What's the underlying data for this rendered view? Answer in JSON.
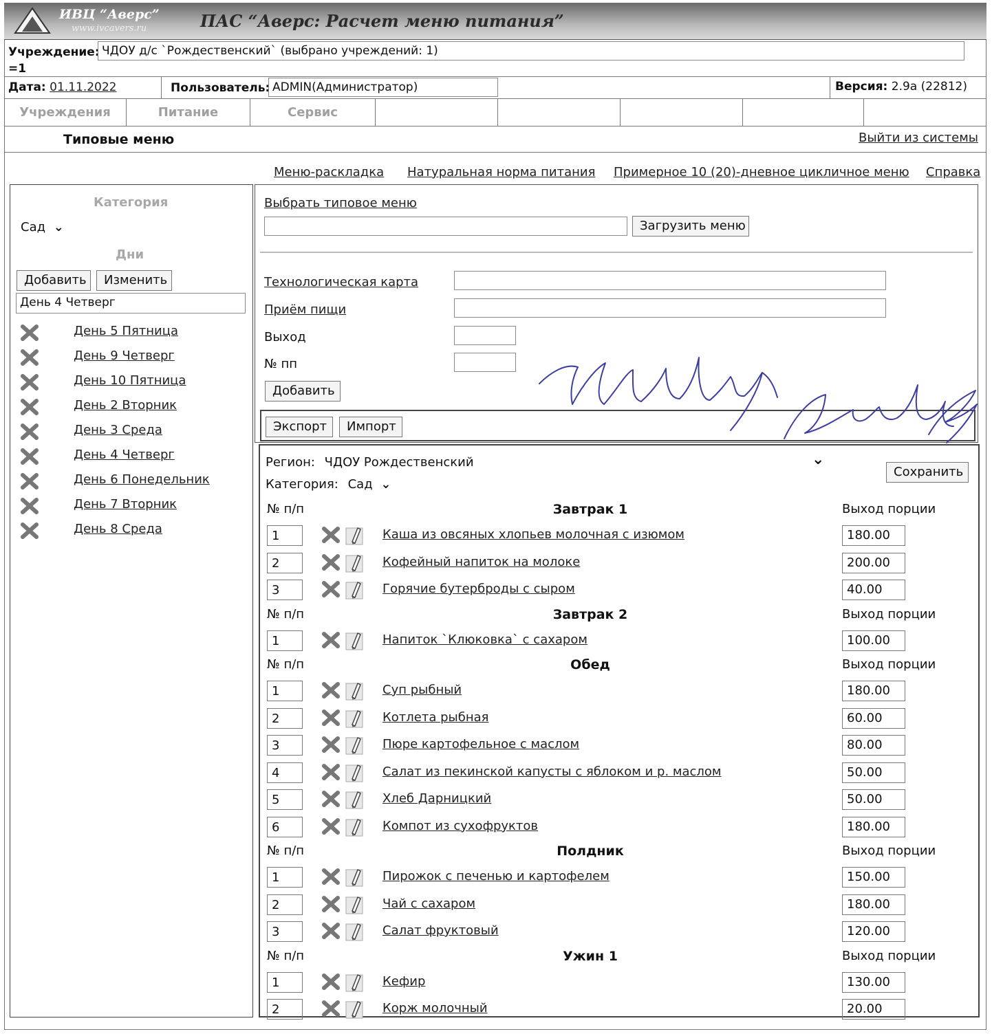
{
  "header": {
    "brand": "ИВЦ “Аверс”",
    "url": "www.ivcavers.ru",
    "app_title": "ПАС “Аверс: Расчет меню питания”"
  },
  "institution": {
    "label": "Учреждение:",
    "value": "ЧДОУ д/с `Рождественский` (выбрано учреждений: 1)",
    "extra": "=1"
  },
  "info": {
    "date_label": "Дата:",
    "date_value": "01.11.2022",
    "user_label": "Пользователь:",
    "user_value": "ADMIN(Администратор)",
    "version_label": "Версия:",
    "version_value": "2.9а (22812)"
  },
  "nav": {
    "items": [
      "Учреждения",
      "Питание",
      "Сервис"
    ]
  },
  "subheader": {
    "title": "Типовые меню",
    "logout": "Выйти из системы"
  },
  "links": {
    "layout": "Меню-раскладка",
    "norm": "Натуральная норма питания",
    "cyclic": "Примерное 10 (20)-дневное цикличное меню",
    "help": "Справка"
  },
  "left": {
    "category_label": "Категория",
    "category_value": "Сад",
    "days_label": "Дни",
    "add_btn": "Добавить",
    "edit_btn": "Изменить",
    "day_input": "День 4 Четверг",
    "days": [
      "День 5 Пятница",
      "День 9 Четверг",
      "День 10 Пятница",
      "День 2 Вторник",
      "День 3 Среда",
      "День 4 Четверг",
      "День 6 Понедельник",
      "День 7 Вторник",
      "День 8 Среда"
    ]
  },
  "form": {
    "choose_menu": "Выбрать типовое меню",
    "load_btn": "Загрузить меню",
    "tech_card": "Технологическая карта",
    "meal": "Приём пищи",
    "output": "Выход",
    "num": "№ пп",
    "add_btn": "Добавить",
    "export_btn": "Экспорт",
    "import_btn": "Импорт"
  },
  "menu": {
    "region_label": "Регион:",
    "region_value": "ЧДОУ Рождественский",
    "category_label": "Категория:",
    "category_value": "Сад",
    "save_btn": "Сохранить",
    "num_header": "№ п/п",
    "output_header": "Выход порции",
    "sections": [
      {
        "name": "Завтрак 1",
        "items": [
          {
            "num": "1",
            "dish": "Каша из овсяных хлопьев молочная с изюмом",
            "qty": "180.00"
          },
          {
            "num": "2",
            "dish": "Кофейный напиток на молоке",
            "qty": "200.00"
          },
          {
            "num": "3",
            "dish": "Горячие бутерброды с сыром",
            "qty": "40.00"
          }
        ]
      },
      {
        "name": "Завтрак 2",
        "items": [
          {
            "num": "1",
            "dish": "Напиток `Клюковка` с сахаром",
            "qty": "100.00"
          }
        ]
      },
      {
        "name": "Обед",
        "items": [
          {
            "num": "1",
            "dish": "Суп рыбный",
            "qty": "180.00"
          },
          {
            "num": "2",
            "dish": "Котлета рыбная",
            "qty": "60.00"
          },
          {
            "num": "3",
            "dish": "Пюре картофельное с маслом",
            "qty": "80.00"
          },
          {
            "num": "4",
            "dish": "Салат из пекинской капусты с яблоком и р. маслом",
            "qty": "50.00"
          },
          {
            "num": "5",
            "dish": "Хлеб Дарницкий",
            "qty": "50.00"
          },
          {
            "num": "6",
            "dish": "Компот из сухофруктов",
            "qty": "180.00"
          }
        ]
      },
      {
        "name": "Полдник",
        "items": [
          {
            "num": "1",
            "dish": "Пирожок с печенью и картофелем",
            "qty": "150.00"
          },
          {
            "num": "2",
            "dish": "Чай с сахаром",
            "qty": "180.00"
          },
          {
            "num": "3",
            "dish": "Салат фруктовый",
            "qty": "120.00"
          }
        ]
      },
      {
        "name": "Ужин 1",
        "items": [
          {
            "num": "1",
            "dish": "Кефир",
            "qty": "130.00"
          },
          {
            "num": "2",
            "dish": "Корж молочный",
            "qty": "20.00"
          }
        ]
      }
    ]
  },
  "handwriting": {
    "line1": "Четверг",
    "line2": "День 9"
  },
  "colors": {
    "header_dark": "#6a6a6a",
    "nav_text": "#a0a0a0",
    "ink": "#3d3fa0"
  }
}
